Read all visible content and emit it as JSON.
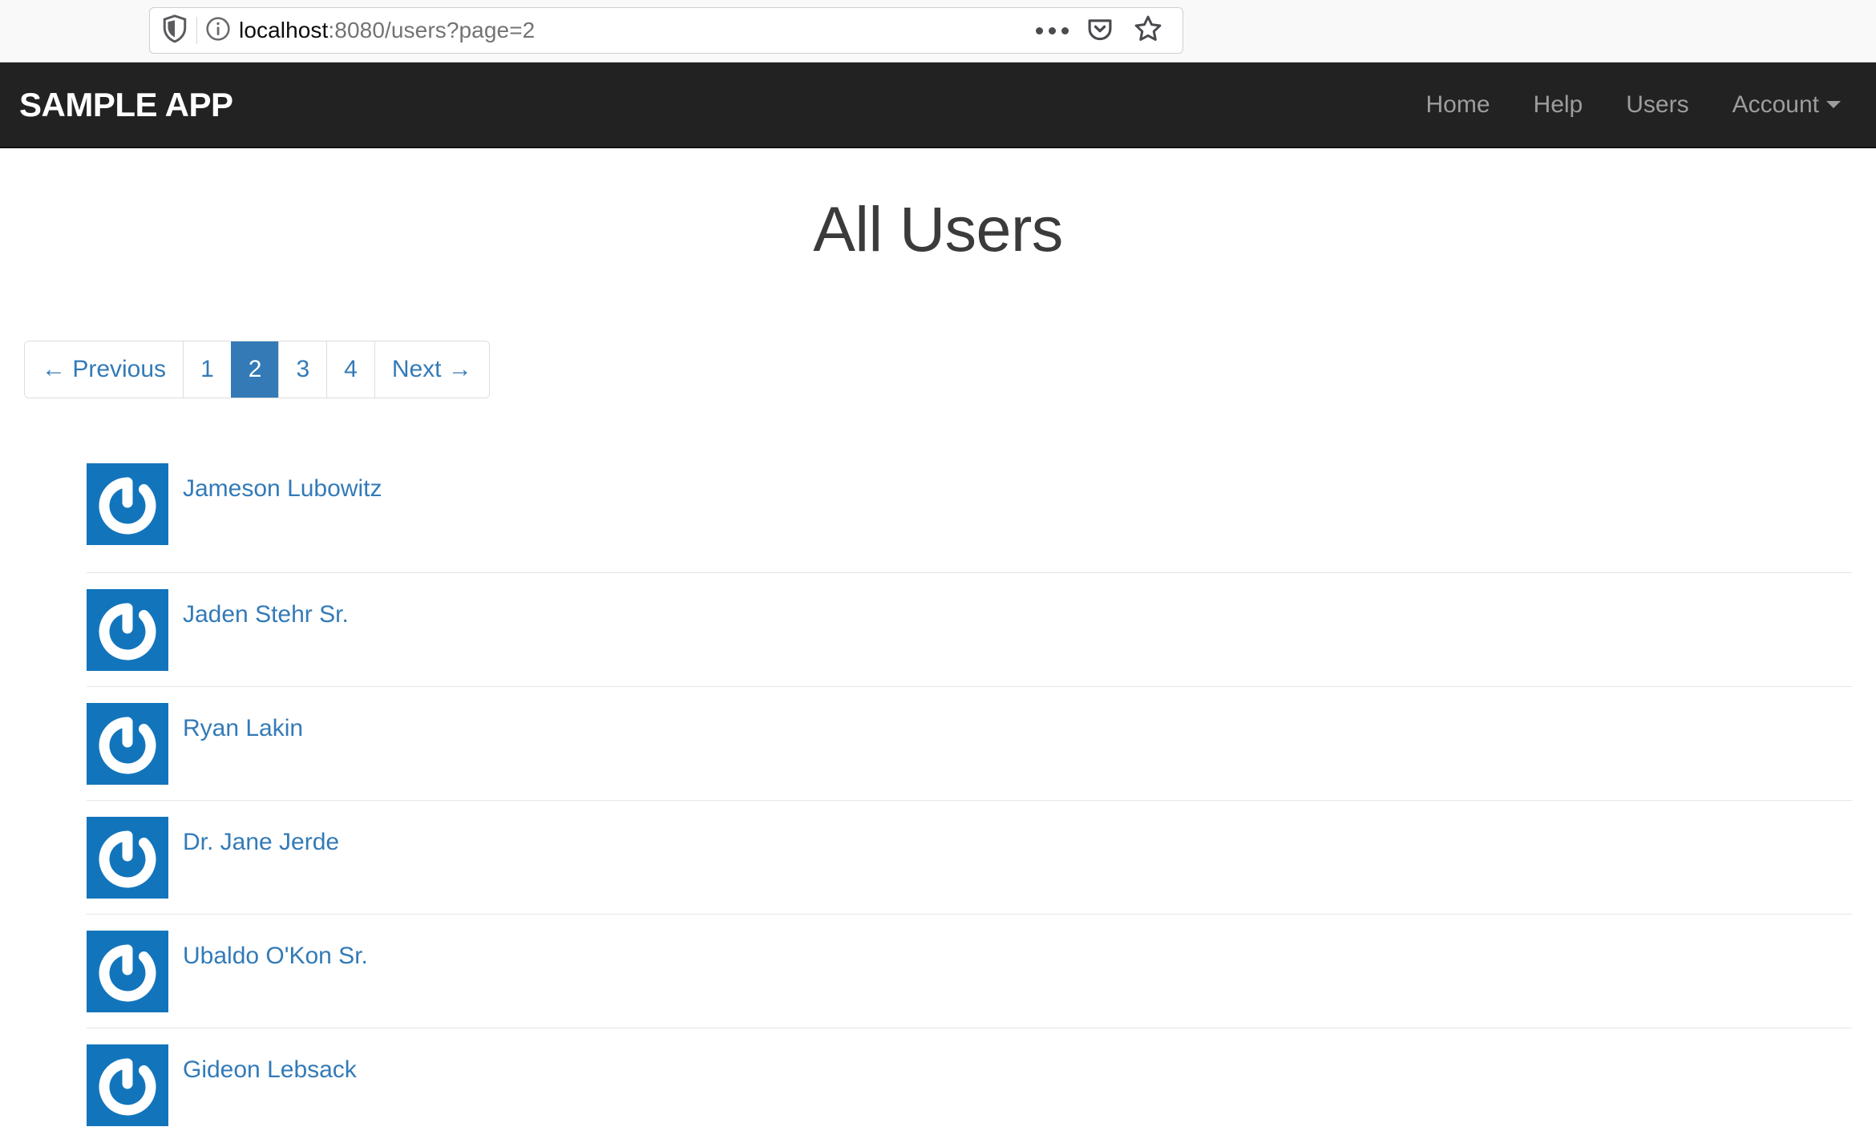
{
  "browser": {
    "url_prefix": "localhost",
    "url_suffix": ":8080/users?page=2",
    "url_full": "localhost:8080/users?page=2",
    "icons": {
      "shield": "shield-icon",
      "info": "info-circle-icon",
      "more": "more-dots-icon",
      "pocket": "pocket-icon",
      "bookmark": "star-bookmark-icon"
    }
  },
  "navbar": {
    "brand": "SAMPLE APP",
    "links": [
      {
        "label": "Home"
      },
      {
        "label": "Help"
      },
      {
        "label": "Users"
      },
      {
        "label": "Account",
        "caret": true
      }
    ],
    "bg_color": "#222222",
    "link_color": "#9d9d9d"
  },
  "main": {
    "title": "All Users",
    "pagination": {
      "previous_label": "← Previous",
      "next_label": "Next →",
      "pages": [
        "1",
        "2",
        "3",
        "4"
      ],
      "active_page": "2",
      "active_color": "#337ab7",
      "link_color": "#337ab7"
    },
    "users": [
      {
        "name": "Jameson Lubowitz",
        "avatar": "gravatar-icon"
      },
      {
        "name": "Jaden Stehr Sr.",
        "avatar": "gravatar-icon"
      },
      {
        "name": "Ryan Lakin",
        "avatar": "gravatar-icon"
      },
      {
        "name": "Dr. Jane Jerde",
        "avatar": "gravatar-icon"
      },
      {
        "name": "Ubaldo O'Kon Sr.",
        "avatar": "gravatar-icon"
      },
      {
        "name": "Gideon Lebsack",
        "avatar": "gravatar-icon"
      }
    ],
    "avatar_bg": "#1275bc",
    "link_color": "#337ab7"
  }
}
